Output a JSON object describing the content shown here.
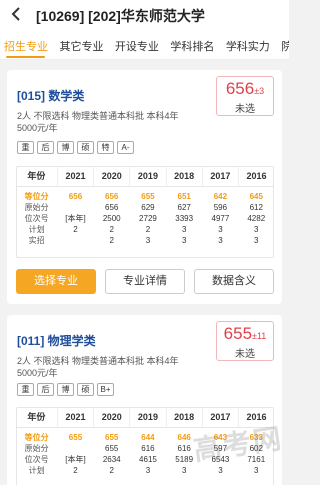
{
  "header": {
    "title": "[10269] [202]华东师范大学",
    "back_icon": "arrow-left-icon"
  },
  "tabs": [
    "招生专业",
    "其它专业",
    "开设专业",
    "学科排名",
    "学科实力",
    "院校实"
  ],
  "columns": [
    "年份",
    "2021",
    "2020",
    "2019",
    "2018",
    "2017",
    "2016"
  ],
  "row_labels": [
    "等位分",
    "原始分",
    "位次号",
    "计划",
    "实招"
  ],
  "buttons": {
    "select": "选择专业",
    "detail": "专业详情",
    "meaning": "数据含义"
  },
  "watermark": "高考网",
  "majors": [
    {
      "name": "[015] 数学类",
      "score": "656",
      "delta": "±3",
      "status": "未选",
      "info1": "2人  不限选科  物理类普通本科批  本科4年",
      "info2": "5000元/年",
      "tags": [
        "重",
        "后",
        "博",
        "硕",
        "特",
        "A-"
      ],
      "rows": [
        [
          "656",
          "656",
          "655",
          "651",
          "642",
          "645"
        ],
        [
          "",
          "656",
          "629",
          "627",
          "596",
          "612"
        ],
        [
          "[本年]",
          "2500",
          "2729",
          "3393",
          "4977",
          "4282"
        ],
        [
          "2",
          "2",
          "2",
          "3",
          "3",
          "3"
        ],
        [
          "",
          "2",
          "3",
          "3",
          "3",
          "3"
        ]
      ]
    },
    {
      "name": "[011] 物理学类",
      "score": "655",
      "delta": "±11",
      "status": "未选",
      "info1": "2人  不限选科  物理类普通本科批  本科4年",
      "info2": "5000元/年",
      "tags": [
        "重",
        "后",
        "博",
        "硕",
        "B+"
      ],
      "rows": [
        [
          "655",
          "655",
          "644",
          "646",
          "643",
          "633"
        ],
        [
          "",
          "655",
          "616",
          "616",
          "597",
          "602"
        ],
        [
          "[本年]",
          "2634",
          "4615",
          "5189",
          "6543",
          "7161"
        ],
        [
          "2",
          "2",
          "3",
          "3",
          "3",
          "3"
        ]
      ]
    }
  ],
  "colors": {
    "accent": "#f39c12",
    "primary_button": "#f5a623",
    "score": "#e0414a",
    "major_name": "#1f4e9b"
  }
}
